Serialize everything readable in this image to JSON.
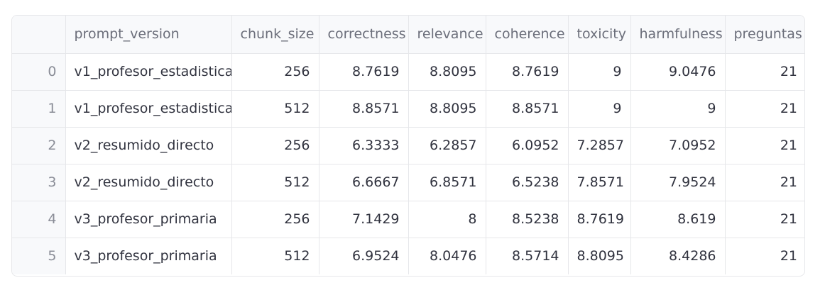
{
  "table": {
    "columns": [
      "",
      "prompt_version",
      "chunk_size",
      "correctness",
      "relevance",
      "coherence",
      "toxicity",
      "harmfulness",
      "preguntas"
    ],
    "rows": [
      {
        "index": "0",
        "prompt_version": "v1_profesor_estadistica",
        "chunk_size": "256",
        "correctness": "8.7619",
        "relevance": "8.8095",
        "coherence": "8.7619",
        "toxicity": "9",
        "harmfulness": "9.0476",
        "preguntas": "21"
      },
      {
        "index": "1",
        "prompt_version": "v1_profesor_estadistica",
        "chunk_size": "512",
        "correctness": "8.8571",
        "relevance": "8.8095",
        "coherence": "8.8571",
        "toxicity": "9",
        "harmfulness": "9",
        "preguntas": "21"
      },
      {
        "index": "2",
        "prompt_version": "v2_resumido_directo",
        "chunk_size": "256",
        "correctness": "6.3333",
        "relevance": "6.2857",
        "coherence": "6.0952",
        "toxicity": "7.2857",
        "harmfulness": "7.0952",
        "preguntas": "21"
      },
      {
        "index": "3",
        "prompt_version": "v2_resumido_directo",
        "chunk_size": "512",
        "correctness": "6.6667",
        "relevance": "6.8571",
        "coherence": "6.5238",
        "toxicity": "7.8571",
        "harmfulness": "7.9524",
        "preguntas": "21"
      },
      {
        "index": "4",
        "prompt_version": "v3_profesor_primaria",
        "chunk_size": "256",
        "correctness": "7.1429",
        "relevance": "8",
        "coherence": "8.5238",
        "toxicity": "8.7619",
        "harmfulness": "8.619",
        "preguntas": "21"
      },
      {
        "index": "5",
        "prompt_version": "v3_profesor_primaria",
        "chunk_size": "512",
        "correctness": "6.9524",
        "relevance": "8.0476",
        "coherence": "8.5714",
        "toxicity": "8.8095",
        "harmfulness": "8.4286",
        "preguntas": "21"
      }
    ]
  },
  "colors": {
    "border": "#e6e7ea",
    "header_bg": "#f8f9fb",
    "header_text": "#6b6e7a",
    "cell_text": "#31333f",
    "index_text": "#8a8d97"
  }
}
